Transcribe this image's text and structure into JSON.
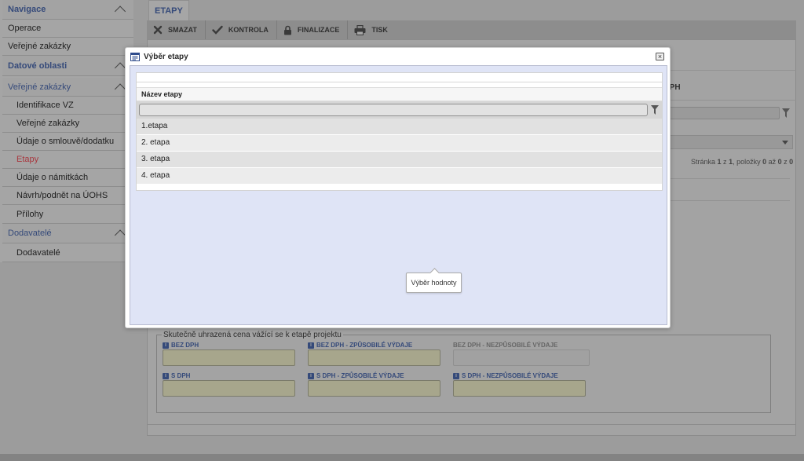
{
  "sidebar": {
    "navigation_header": "Navigace",
    "nav_items": [
      "Operace",
      "Veřejné zakázky"
    ],
    "data_areas_header": "Datové oblasti",
    "public_contracts_header": "Veřejné zakázky",
    "public_contracts_items": [
      "Identifikace VZ",
      "Veřejné zakázky",
      "Údaje o smlouvě/dodatku",
      "Etapy",
      "Údaje o námitkách",
      "Návrh/podnět na ÚOHS",
      "Přílohy"
    ],
    "suppliers_header": "Dodavatelé",
    "suppliers_items": [
      "Dodavatelé"
    ],
    "active_item": "Etapy",
    "colors": {
      "header": "#354a7a",
      "active": "#a8383f"
    }
  },
  "main": {
    "tab_label": "ETAPY",
    "toolbar": {
      "delete_label": "SMAZAT",
      "check_label": "KONTROLA",
      "finalize_label": "FINALIZACE",
      "print_label": "TISK"
    },
    "background_column_label": "S DPH",
    "pager": {
      "prefix": "Stránka ",
      "page": "1",
      "of": " z ",
      "total_pages": "1",
      "items_label": ", položky ",
      "from": "0",
      "to_label": " až ",
      "to": "0",
      "of2": " z ",
      "total_items": "0"
    },
    "costs": {
      "legend": "Skutečně uhrazená cena vážící se k etapě projektu",
      "info_glyph": "i",
      "bez_dph": "BEZ DPH",
      "bez_dph_eligible": "BEZ DPH - ZPŮSOBILÉ VÝDAJE",
      "bez_dph_ineligible": "BEZ DPH - NEZPŮSOBILÉ VÝDAJE",
      "s_dph": "S DPH",
      "s_dph_eligible": "S DPH - ZPŮSOBILÉ VÝDAJE",
      "s_dph_ineligible": "S DPH - NEZPŮSOBILÉ VÝDAJE"
    }
  },
  "modal": {
    "title": "Výběr etapy",
    "close_glyph": "×",
    "grid": {
      "column_header": "Název etapy",
      "rows": [
        "1.etapa",
        "2. etapa",
        "3. etapa",
        "4. etapa"
      ]
    },
    "tooltip": "Výběr hodnoty"
  }
}
